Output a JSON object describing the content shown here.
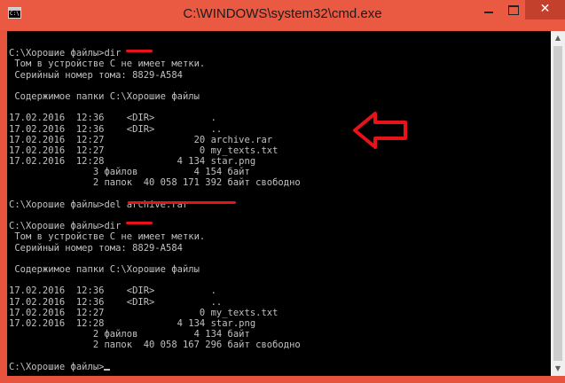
{
  "window": {
    "title": "C:\\WINDOWS\\system32\\cmd.exe",
    "icon_glyph": "C:\\."
  },
  "controls": {
    "minimize_icon": "minimize-icon",
    "maximize_icon": "maximize-icon",
    "close_glyph": "✕"
  },
  "console": {
    "lines": [
      "",
      "C:\\Хорошие файлы>dir",
      " Том в устройстве C не имеет метки.",
      " Серийный номер тома: 8829-A584",
      "",
      " Содержимое папки C:\\Хорошие файлы",
      "",
      "17.02.2016  12:36    <DIR>          .",
      "17.02.2016  12:36    <DIR>          ..",
      "17.02.2016  12:27                20 archive.rar",
      "17.02.2016  12:27                 0 my_texts.txt",
      "17.02.2016  12:28             4 134 star.png",
      "               3 файлов          4 154 байт",
      "               2 папок  40 058 171 392 байт свободно",
      "",
      "C:\\Хорошие файлы>del archive.rar",
      "",
      "C:\\Хорошие файлы>dir",
      " Том в устройстве C не имеет метки.",
      " Серийный номер тома: 8829-A584",
      "",
      " Содержимое папки C:\\Хорошие файлы",
      "",
      "17.02.2016  12:36    <DIR>          .",
      "17.02.2016  12:36    <DIR>          ..",
      "17.02.2016  12:27                 0 my_texts.txt",
      "17.02.2016  12:28             4 134 star.png",
      "               2 файлов          4 134 байт",
      "               2 папок  40 058 167 296 байт свободно",
      "",
      "C:\\Хорошие файлы>"
    ]
  },
  "annotations": {
    "color": "#e8121a"
  },
  "scrollbar": {
    "up_glyph": "▲",
    "down_glyph": "▼"
  }
}
